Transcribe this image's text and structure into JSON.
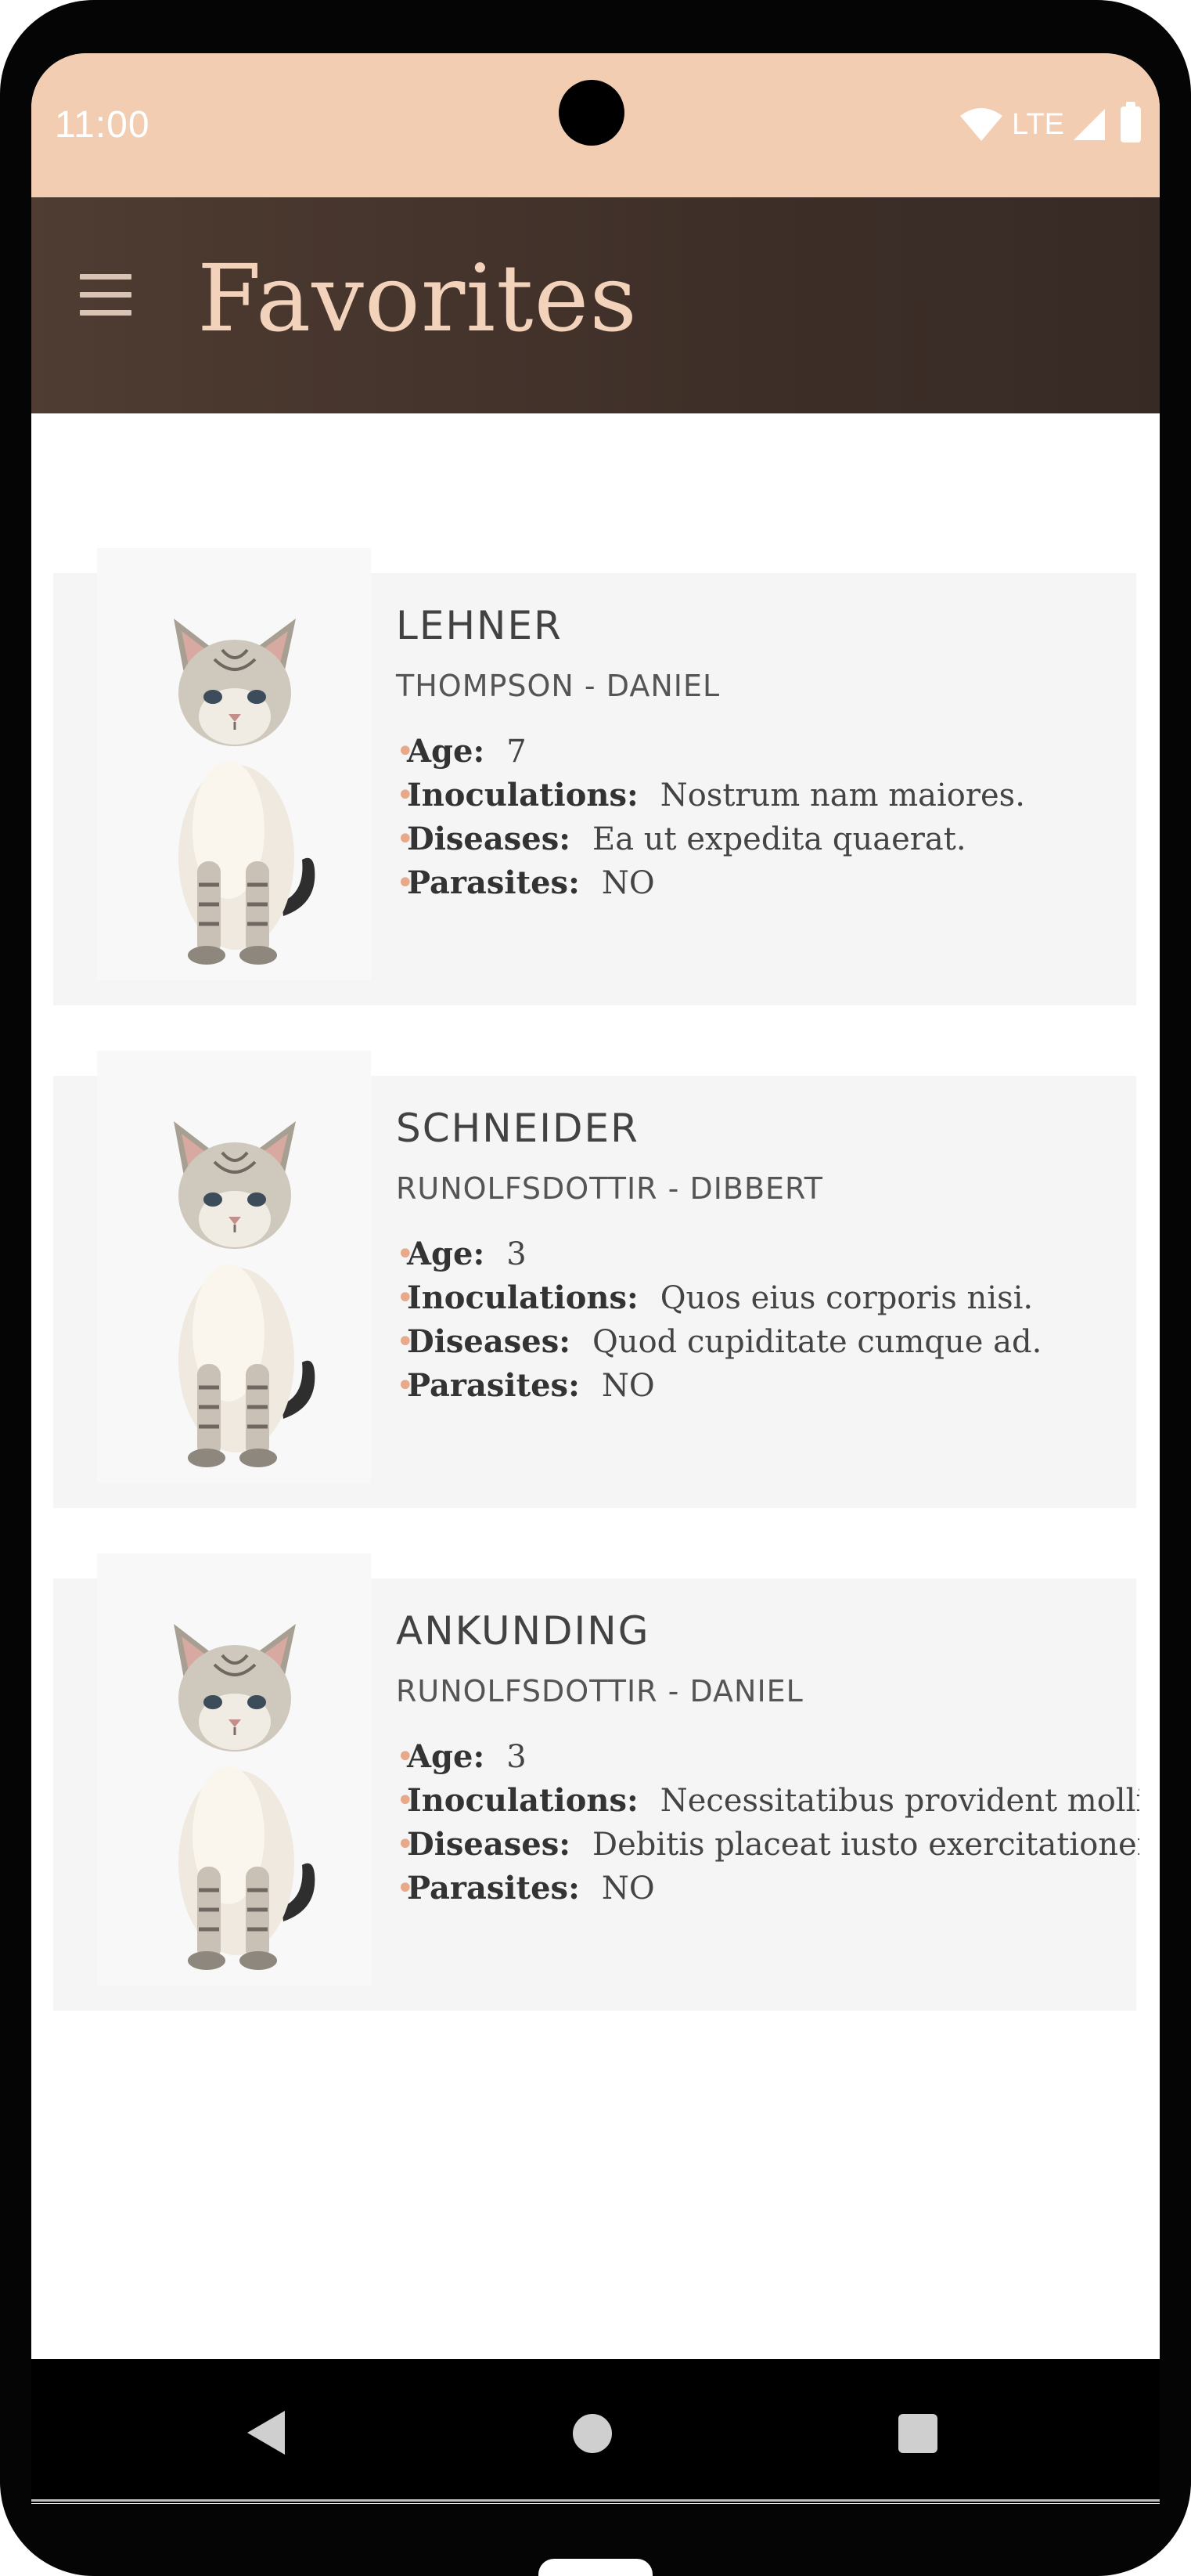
{
  "status_bar": {
    "time": "11:00",
    "network": "LTE",
    "icons": [
      "wifi-icon",
      "signal-icon",
      "battery-icon"
    ]
  },
  "app_bar": {
    "title": "Favorites",
    "menu_icon": "menu-icon"
  },
  "colors": {
    "status_bar_bg": "#f2cdb2",
    "app_bar_bg": "#3e2f28",
    "title_color": "#f3d2bc",
    "card_bg": "#f5f5f5",
    "bullet_color": "#e8a98a"
  },
  "favorites": [
    {
      "name": "LEHNER",
      "subtitle": "THOMPSON - DANIEL",
      "details": [
        {
          "label": "Age:",
          "value": "7"
        },
        {
          "label": "Inoculations:",
          "value": "Nostrum nam maiores."
        },
        {
          "label": "Diseases:",
          "value": "Ea ut expedita quaerat."
        },
        {
          "label": "Parasites:",
          "value": "NO"
        }
      ]
    },
    {
      "name": "SCHNEIDER",
      "subtitle": "RUNOLFSDOTTIR - DIBBERT",
      "details": [
        {
          "label": "Age:",
          "value": "3"
        },
        {
          "label": "Inoculations:",
          "value": "Quos eius corporis nisi."
        },
        {
          "label": "Diseases:",
          "value": "Quod cupiditate cumque ad."
        },
        {
          "label": "Parasites:",
          "value": "NO"
        }
      ]
    },
    {
      "name": "ANKUNDING",
      "subtitle": "RUNOLFSDOTTIR - DANIEL",
      "details": [
        {
          "label": "Age:",
          "value": "3"
        },
        {
          "label": "Inoculations:",
          "value": "Necessitatibus provident mollitia"
        },
        {
          "label": "Diseases:",
          "value": "Debitis placeat iusto exercitationem."
        },
        {
          "label": "Parasites:",
          "value": "NO"
        }
      ]
    }
  ],
  "nav_bar": {
    "buttons": [
      "back-icon",
      "home-icon",
      "recents-icon"
    ]
  }
}
